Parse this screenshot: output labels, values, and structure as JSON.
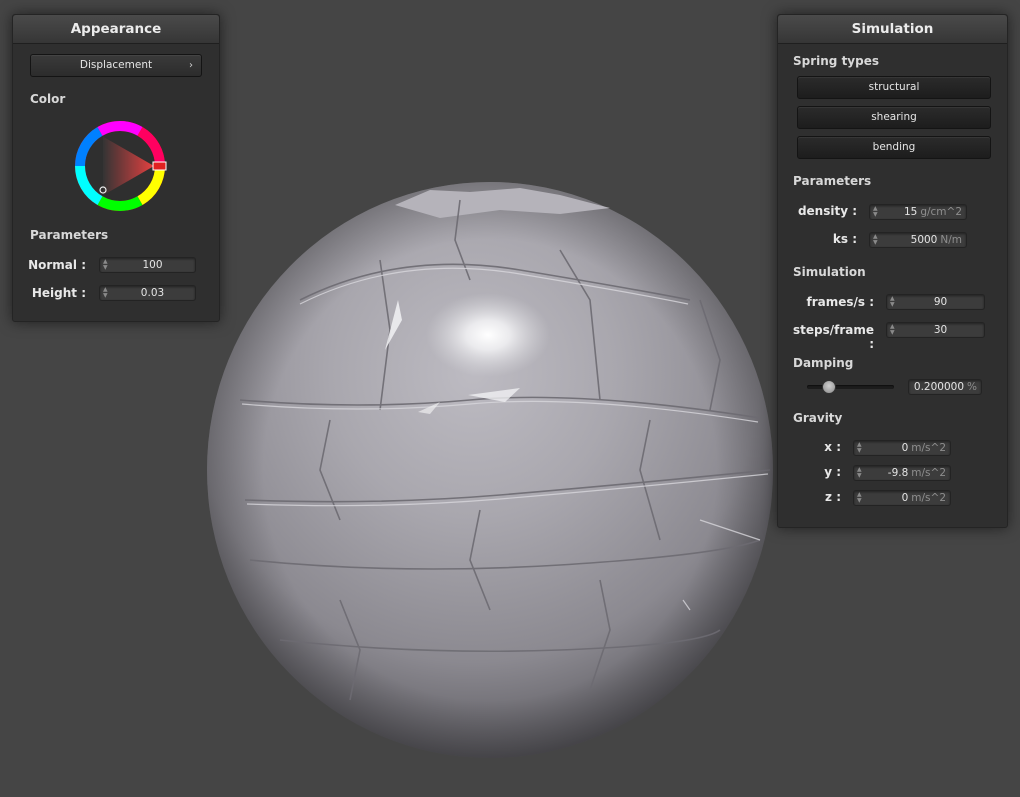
{
  "appearance": {
    "title": "Appearance",
    "displacement_button": "Displacement",
    "color_label": "Color",
    "parameters_label": "Parameters",
    "normal_label": "Normal :",
    "normal_value": "100",
    "height_label": "Height :",
    "height_value": "0.03",
    "color_hue": "#e02020"
  },
  "simulation": {
    "title": "Simulation",
    "spring_types_label": "Spring types",
    "springs": [
      "structural",
      "shearing",
      "bending"
    ],
    "parameters_label": "Parameters",
    "density_label": "density :",
    "density_value": "15",
    "density_unit": "g/cm^2",
    "ks_label": "ks :",
    "ks_value": "5000",
    "ks_unit": "N/m",
    "simulation_label": "Simulation",
    "fps_label": "frames/s :",
    "fps_value": "90",
    "steps_label": "steps/frame :",
    "steps_value": "30",
    "damping_label": "Damping",
    "damping_value": "0.200000",
    "damping_unit": "%",
    "damping_fraction": 0.2,
    "gravity_label": "Gravity",
    "gx_label": "x :",
    "gx_value": "0",
    "gy_label": "y :",
    "gy_value": "-9.8",
    "gz_label": "z :",
    "gz_value": "0",
    "gravity_unit": "m/s^2"
  },
  "icons": [
    "chevron-right-icon",
    "spinner-icon",
    "color-wheel-icon"
  ]
}
